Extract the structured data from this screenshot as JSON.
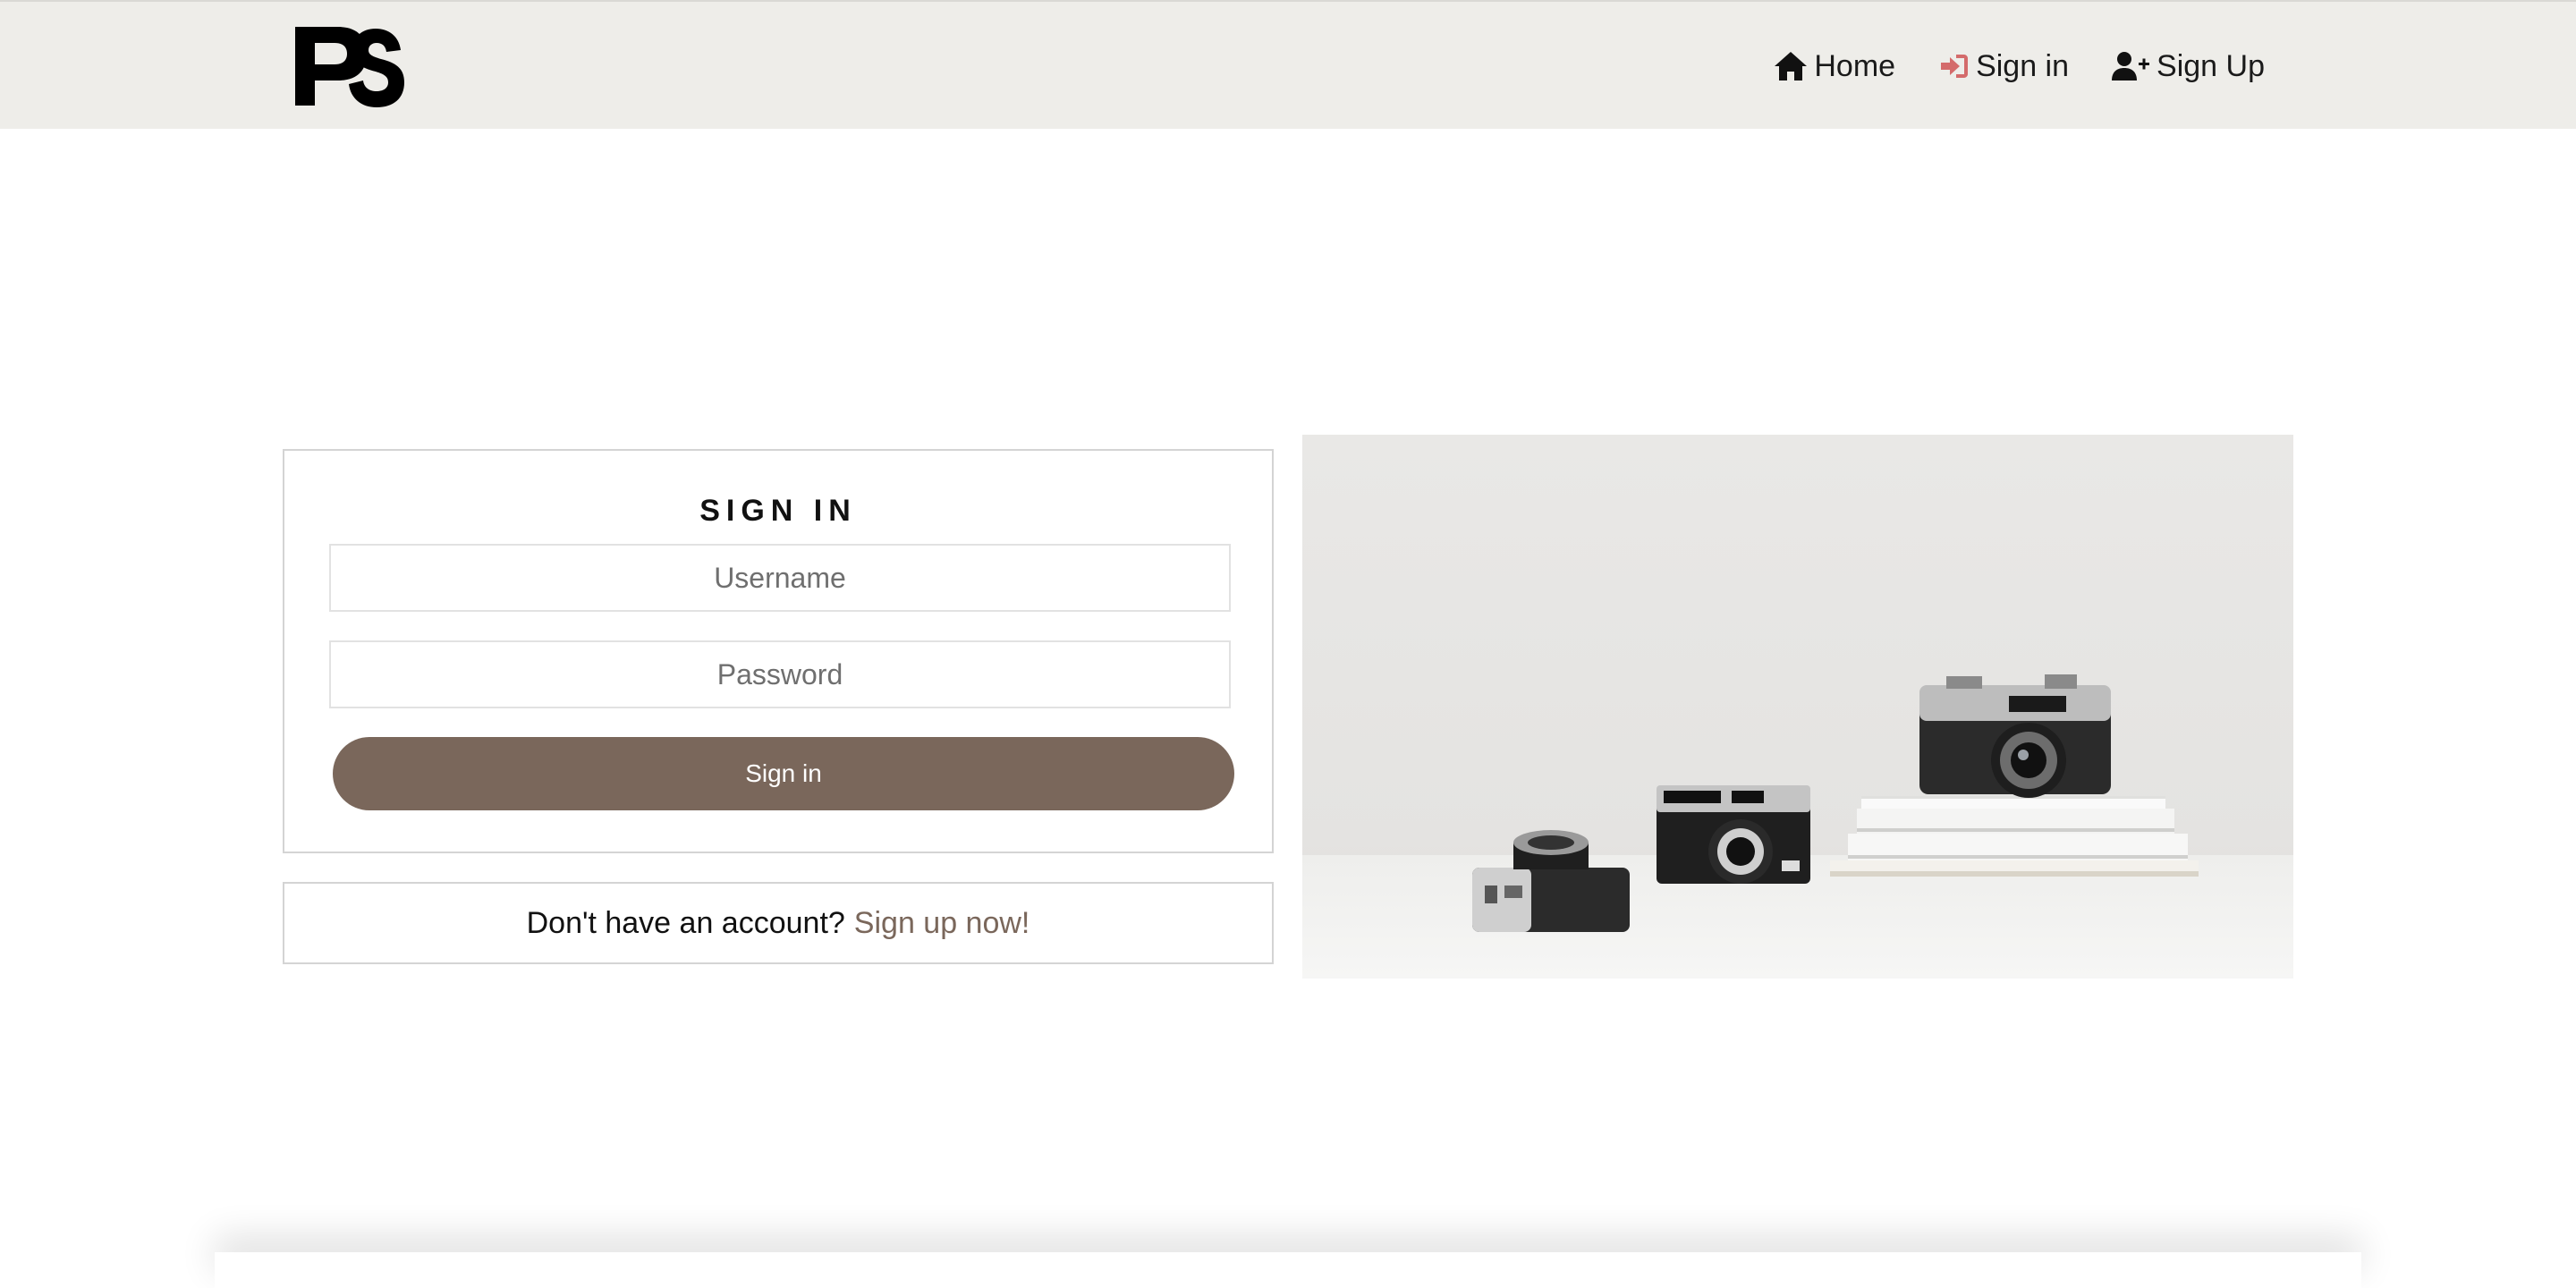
{
  "navbar": {
    "logo_alt": "PS",
    "links": [
      {
        "label": "Home",
        "icon": "home-icon"
      },
      {
        "label": "Sign in",
        "icon": "sign-in-icon"
      },
      {
        "label": "Sign Up",
        "icon": "user-plus-icon"
      }
    ]
  },
  "signin_form": {
    "title": "SIGN IN",
    "username_placeholder": "Username",
    "password_placeholder": "Password",
    "submit_label": "Sign in"
  },
  "signup_prompt": {
    "text": "Don't have an account?",
    "link_label": "Sign up now!"
  },
  "colors": {
    "navbar_bg": "#eeede9",
    "accent_brown": "#7a675b",
    "sign_in_icon": "#d46b6b"
  }
}
